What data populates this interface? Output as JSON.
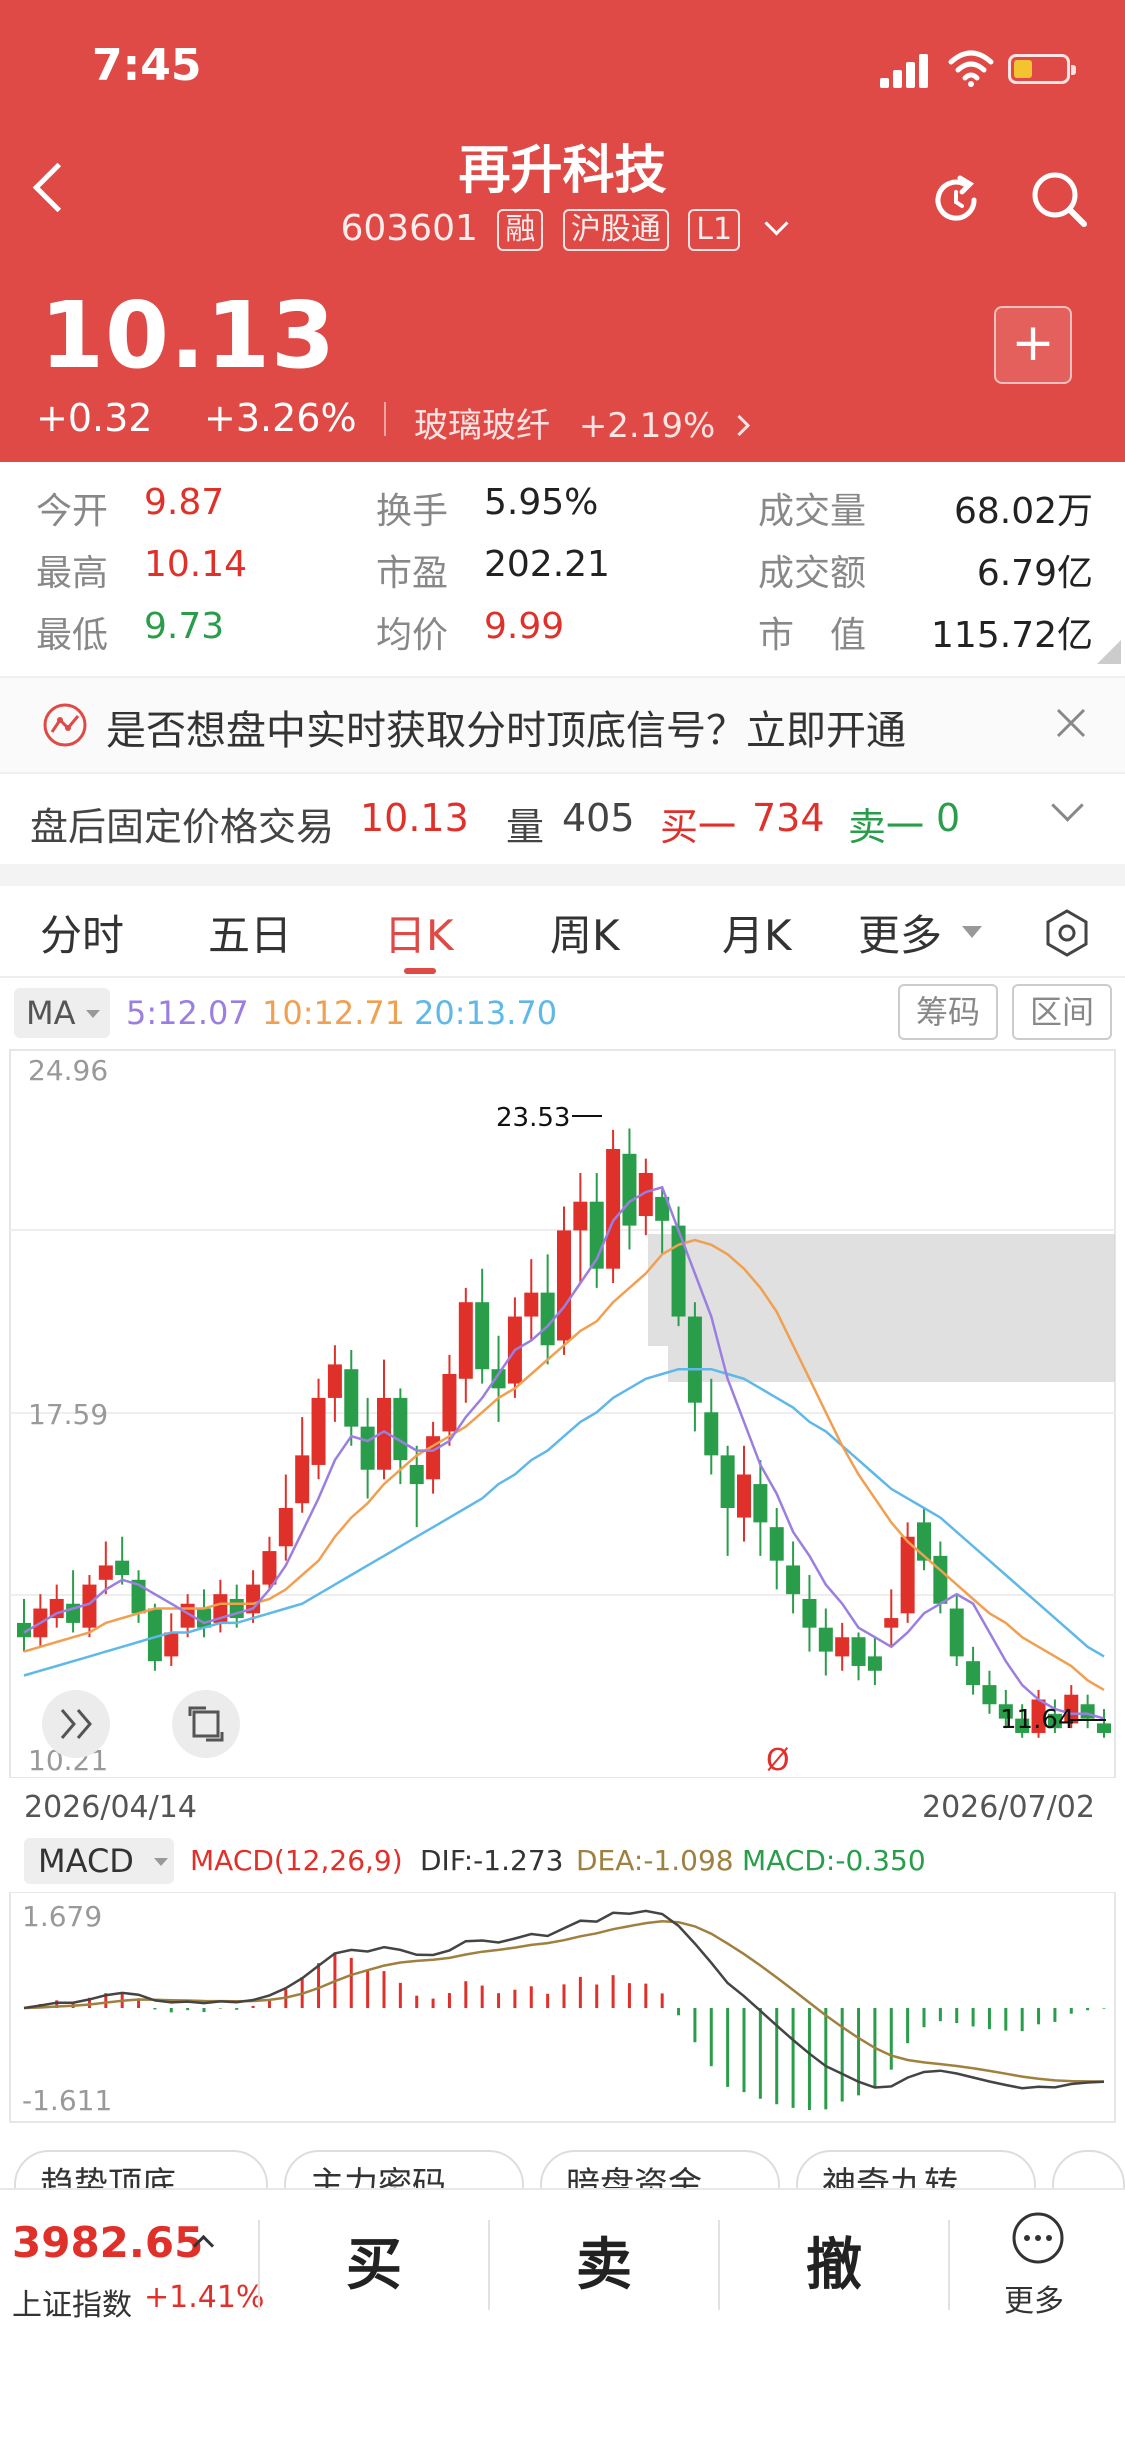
{
  "status_bar": {
    "time": "7:45"
  },
  "header": {
    "title": "再升科技",
    "code": "603601",
    "tags": [
      "融",
      "沪股通",
      "L1"
    ],
    "price": "10.13",
    "change": "+0.32",
    "change_pct": "+3.26%",
    "sector": "玻璃玻纤",
    "sector_pct": "+2.19%",
    "add_label": "+"
  },
  "stats": {
    "open_label": "今开",
    "open": "9.87",
    "high_label": "最高",
    "high": "10.14",
    "low_label": "最低",
    "low": "9.73",
    "turnover_label": "换手",
    "turnover": "5.95%",
    "pe_label": "市盈",
    "pe": "202.21",
    "avg_label": "均价",
    "avg": "9.99",
    "volume_label": "成交量",
    "volume": "68.02万",
    "amount_label": "成交额",
    "amount": "6.79亿",
    "mcap_label": "市　值",
    "mcap": "115.72亿"
  },
  "banner": {
    "text": "是否想盘中实时获取分时顶底信号？立即开通"
  },
  "after_hours": {
    "label": "盘后固定价格交易",
    "price": "10.13",
    "vol_label": "量",
    "vol": "405",
    "bid_label": "买一",
    "bid": "734",
    "ask_label": "卖一",
    "ask": "0"
  },
  "tabs": [
    "分时",
    "五日",
    "日K",
    "周K",
    "月K",
    "更多"
  ],
  "ma": {
    "label": "MA",
    "ma5": "5:12.07",
    "ma10": "10:12.71",
    "ma20": "20:13.70",
    "btn1": "筹码",
    "btn2": "区间"
  },
  "kchart": {
    "y_top": "24.96",
    "y_mid": "17.59",
    "y_bot": "10.21",
    "high_mark": "23.53",
    "low_mark": "11.64",
    "date_start": "2026/04/14",
    "date_end": "2026/07/02",
    "divider_mark": "Ø"
  },
  "macd": {
    "label": "MACD",
    "params": "MACD(12,26,9)",
    "dif": "DIF:-1.273",
    "dea": "DEA:-1.098",
    "macd": "MACD:-0.350",
    "y_top": "1.679",
    "y_bot": "-1.611"
  },
  "chips": [
    "趋势顶底",
    "主力密码",
    "暗盘资金",
    "神奇九转"
  ],
  "bottom": {
    "index_value": "3982.65",
    "index_name": "上证指数",
    "index_pct": "+1.41%",
    "buy": "买",
    "sell": "卖",
    "cancel": "撤",
    "more": "更多"
  },
  "colors": {
    "up": "#e0302a",
    "down": "#2a9d4a",
    "header": "#e04a46",
    "ma5": "#9b7fe0",
    "ma10": "#f0a050",
    "ma20": "#5fb8e8"
  },
  "chart_data": {
    "type": "candlestick",
    "ylim": [
      10.21,
      24.96
    ],
    "x_start": "2026/04/14",
    "x_end": "2026/07/02",
    "candles": [
      [
        13.2,
        12.9,
        13.7,
        12.6
      ],
      [
        12.9,
        13.5,
        13.8,
        12.7
      ],
      [
        13.3,
        13.7,
        14.0,
        13.1
      ],
      [
        13.6,
        13.2,
        14.3,
        13.0
      ],
      [
        13.1,
        14.0,
        14.2,
        12.9
      ],
      [
        14.1,
        14.4,
        14.9,
        13.8
      ],
      [
        14.5,
        14.2,
        15.0,
        14.0
      ],
      [
        14.1,
        13.4,
        14.3,
        13.2
      ],
      [
        13.5,
        12.4,
        13.6,
        12.2
      ],
      [
        12.5,
        13.0,
        13.4,
        12.3
      ],
      [
        13.1,
        13.6,
        13.8,
        12.9
      ],
      [
        13.5,
        13.1,
        13.9,
        12.9
      ],
      [
        13.2,
        13.8,
        14.1,
        13.0
      ],
      [
        13.7,
        13.3,
        14.0,
        13.1
      ],
      [
        13.4,
        14.0,
        14.3,
        13.2
      ],
      [
        14.0,
        14.7,
        15.0,
        13.9
      ],
      [
        14.8,
        15.6,
        16.3,
        14.5
      ],
      [
        15.7,
        16.7,
        17.5,
        15.5
      ],
      [
        16.5,
        17.9,
        18.3,
        16.2
      ],
      [
        17.9,
        18.6,
        19.0,
        17.4
      ],
      [
        18.5,
        17.3,
        18.9,
        16.9
      ],
      [
        17.3,
        16.4,
        17.9,
        15.8
      ],
      [
        16.4,
        17.9,
        18.7,
        16.2
      ],
      [
        17.9,
        16.6,
        18.1,
        16.1
      ],
      [
        16.5,
        16.1,
        16.9,
        15.2
      ],
      [
        16.2,
        17.1,
        17.4,
        15.9
      ],
      [
        17.2,
        18.4,
        18.8,
        16.9
      ],
      [
        18.3,
        19.9,
        20.2,
        17.8
      ],
      [
        19.9,
        18.5,
        20.6,
        18.2
      ],
      [
        18.5,
        18.1,
        19.2,
        17.4
      ],
      [
        18.2,
        19.6,
        20.0,
        17.9
      ],
      [
        19.6,
        20.1,
        20.8,
        19.1
      ],
      [
        20.1,
        19.0,
        20.9,
        18.6
      ],
      [
        19.1,
        21.4,
        21.9,
        18.8
      ],
      [
        21.4,
        22.0,
        22.6,
        20.3
      ],
      [
        22.0,
        20.6,
        22.6,
        20.2
      ],
      [
        20.6,
        23.1,
        23.5,
        20.3
      ],
      [
        23.0,
        21.5,
        23.53,
        21.0
      ],
      [
        21.7,
        22.6,
        22.9,
        21.3
      ],
      [
        22.1,
        21.6,
        22.3,
        20.9
      ],
      [
        21.5,
        19.6,
        21.9,
        19.4
      ],
      [
        19.6,
        17.8,
        19.9,
        17.2
      ],
      [
        17.6,
        16.7,
        18.3,
        16.3
      ],
      [
        16.7,
        15.6,
        16.9,
        14.6
      ],
      [
        15.4,
        16.3,
        16.9,
        14.9
      ],
      [
        16.1,
        15.3,
        16.6,
        14.6
      ],
      [
        15.2,
        14.5,
        15.6,
        13.9
      ],
      [
        14.4,
        13.8,
        14.9,
        13.4
      ],
      [
        13.7,
        13.1,
        14.2,
        12.6
      ],
      [
        13.1,
        12.6,
        13.5,
        12.1
      ],
      [
        12.5,
        12.9,
        13.2,
        12.2
      ],
      [
        12.9,
        12.3,
        13.0,
        12.0
      ],
      [
        12.5,
        12.2,
        12.9,
        11.9
      ],
      [
        13.1,
        13.3,
        13.9,
        12.7
      ],
      [
        13.4,
        15.0,
        15.3,
        13.2
      ],
      [
        15.3,
        14.5,
        15.6,
        14.3
      ],
      [
        14.6,
        13.6,
        14.9,
        13.4
      ],
      [
        13.5,
        12.5,
        13.8,
        12.3
      ],
      [
        12.4,
        11.9,
        12.7,
        11.7
      ],
      [
        11.9,
        11.5,
        12.2,
        11.3
      ],
      [
        11.5,
        11.2,
        11.8,
        11.0
      ],
      [
        11.2,
        10.9,
        11.5,
        10.8
      ],
      [
        10.9,
        11.6,
        11.8,
        10.8
      ],
      [
        11.3,
        11.0,
        11.6,
        10.9
      ],
      [
        11.1,
        11.7,
        11.9,
        11.0
      ],
      [
        11.5,
        11.2,
        11.7,
        11.0
      ],
      [
        11.1,
        10.9,
        11.4,
        10.8
      ]
    ],
    "ma5": [
      13.0,
      13.2,
      13.4,
      13.5,
      13.6,
      13.9,
      14.1,
      14.0,
      13.8,
      13.6,
      13.4,
      13.2,
      13.3,
      13.4,
      13.5,
      13.9,
      14.4,
      15.1,
      15.8,
      16.6,
      17.1,
      17.0,
      17.2,
      17.0,
      16.8,
      16.8,
      17.0,
      17.5,
      17.9,
      18.4,
      18.9,
      19.1,
      19.4,
      19.8,
      20.3,
      20.8,
      21.6,
      22.0,
      22.2,
      22.3,
      21.4,
      20.5,
      19.6,
      18.3,
      17.4,
      16.5,
      15.9,
      15.1,
      14.6,
      14.0,
      13.6,
      13.1,
      12.9,
      12.7,
      13.0,
      13.4,
      13.6,
      13.8,
      13.6,
      13.0,
      12.4,
      11.9,
      11.6,
      11.4,
      11.3,
      11.3,
      11.2
    ],
    "ma10": [
      12.6,
      12.7,
      12.8,
      12.9,
      13.0,
      13.2,
      13.3,
      13.4,
      13.5,
      13.5,
      13.5,
      13.5,
      13.6,
      13.6,
      13.6,
      13.7,
      13.9,
      14.2,
      14.5,
      15.0,
      15.4,
      15.7,
      16.1,
      16.4,
      16.7,
      16.9,
      17.1,
      17.3,
      17.6,
      17.9,
      18.1,
      18.4,
      18.7,
      19.0,
      19.3,
      19.5,
      19.9,
      20.2,
      20.5,
      20.9,
      21.1,
      21.2,
      21.1,
      20.9,
      20.6,
      20.2,
      19.7,
      19.0,
      18.3,
      17.6,
      16.9,
      16.3,
      15.8,
      15.3,
      14.9,
      14.6,
      14.3,
      14.0,
      13.7,
      13.4,
      13.2,
      12.9,
      12.7,
      12.5,
      12.3,
      12.0,
      11.8
    ],
    "ma20": [
      12.1,
      12.2,
      12.3,
      12.4,
      12.5,
      12.6,
      12.7,
      12.8,
      12.9,
      13.0,
      13.0,
      13.1,
      13.2,
      13.2,
      13.3,
      13.4,
      13.5,
      13.6,
      13.8,
      14.0,
      14.2,
      14.4,
      14.6,
      14.8,
      15.0,
      15.2,
      15.4,
      15.6,
      15.8,
      16.1,
      16.3,
      16.6,
      16.8,
      17.1,
      17.4,
      17.6,
      17.9,
      18.1,
      18.3,
      18.4,
      18.5,
      18.5,
      18.5,
      18.4,
      18.3,
      18.1,
      17.9,
      17.7,
      17.4,
      17.2,
      16.9,
      16.6,
      16.3,
      16.0,
      15.8,
      15.6,
      15.4,
      15.1,
      14.8,
      14.5,
      14.2,
      13.9,
      13.6,
      13.3,
      13.0,
      12.7,
      12.5
    ]
  }
}
